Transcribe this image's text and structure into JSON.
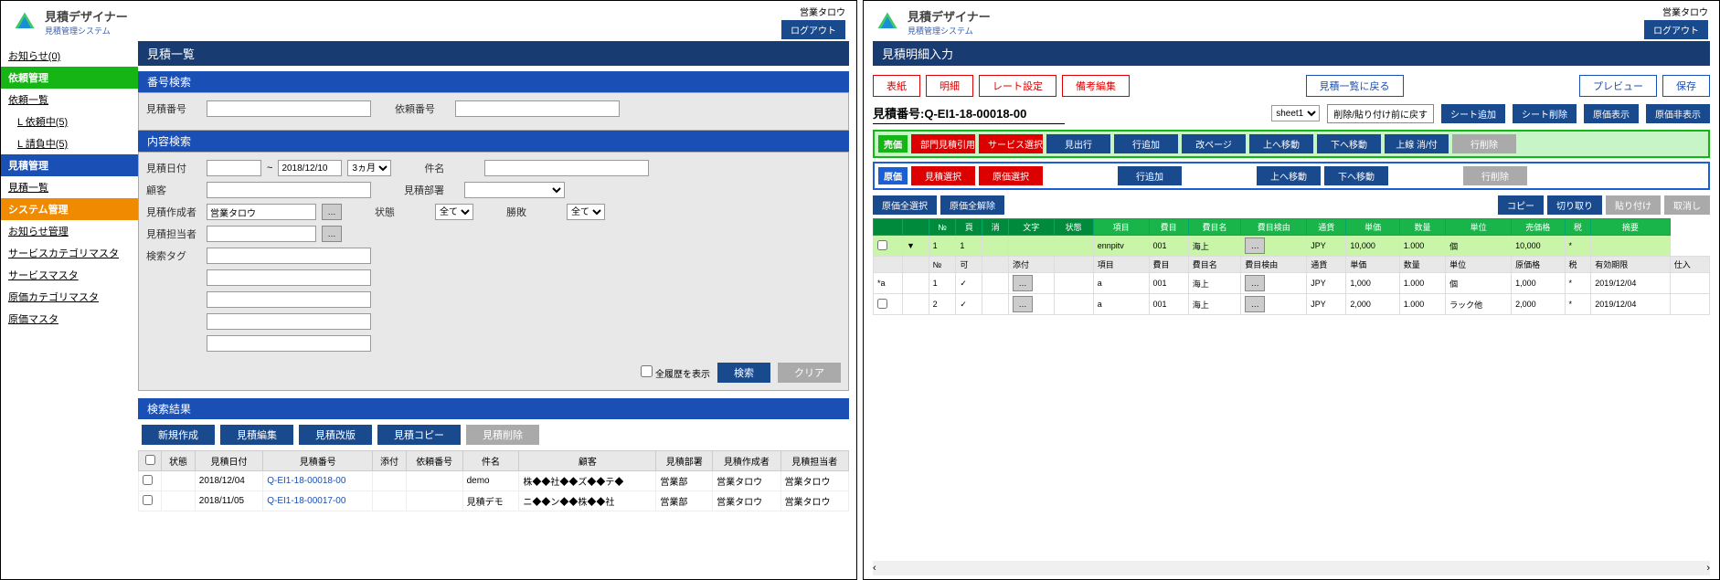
{
  "app": {
    "name": "見積デザイナー",
    "sub": "見積管理システム"
  },
  "user": {
    "name": "営業タロウ",
    "logout": "ログアウト"
  },
  "left": {
    "title": "見積一覧",
    "sidebar": {
      "notice": "お知らせ(0)",
      "s1": "依頼管理",
      "s1a": "依頼一覧",
      "s1b": "L 依頼中(5)",
      "s1c": "L 請負中(5)",
      "s2": "見積管理",
      "s2a": "見積一覧",
      "s3": "システム管理",
      "s3a": "お知らせ管理",
      "s3b": "サービスカテゴリマスタ",
      "s3c": "サービスマスタ",
      "s3d": "原価カテゴリマスタ",
      "s3e": "原価マスタ"
    },
    "sec1": "番号検索",
    "f": {
      "quote_no": "見積番号",
      "req_no": "依頼番号",
      "date": "見積日付",
      "date_to": "2018/12/10",
      "range": "3ヵ月",
      "title": "件名",
      "cust": "顧客",
      "dept": "見積部署",
      "creator": "見積作成者",
      "creator_v": "営業タロウ",
      "status": "状態",
      "status_v": "全て",
      "winrate": "勝敗",
      "winrate_v": "全て",
      "owner": "見積担当者",
      "tag": "検索タグ",
      "showhist": "全履歴を表示",
      "search": "検索",
      "clear": "クリア"
    },
    "sec2": "内容検索",
    "results": "検索結果",
    "actions": {
      "new": "新規作成",
      "edit": "見積編集",
      "rev": "見積改版",
      "copy": "見積コピー",
      "del": "見積削除"
    },
    "cols": {
      "st": "状態",
      "date": "見積日付",
      "qno": "見積番号",
      "att": "添付",
      "rno": "依頼番号",
      "title": "件名",
      "cust": "顧客",
      "dept": "見積部署",
      "creator": "見積作成者",
      "owner": "見積担当者"
    },
    "rows": [
      {
        "date": "2018/12/04",
        "qno": "Q-EI1-18-00018-00",
        "title": "demo",
        "cust": "株◆◆社◆◆ズ◆◆テ◆",
        "dept": "営業部",
        "creator": "営業タロウ",
        "owner": "営業タロウ"
      },
      {
        "date": "2018/11/05",
        "qno": "Q-EI1-18-00017-00",
        "title": "見積デモ",
        "cust": "ニ◆◆ン◆◆株◆◆社",
        "dept": "営業部",
        "creator": "営業タロウ",
        "owner": "営業タロウ"
      }
    ]
  },
  "right": {
    "title": "見積明細入力",
    "top": {
      "cover": "表紙",
      "detail": "明細",
      "rate": "レート設定",
      "note": "備考編集",
      "back": "見積一覧に戻る",
      "preview": "プレビュー",
      "save": "保存"
    },
    "qlabel": "見積番号:Q-EI1-18-00018-00",
    "sheet": "sheet1",
    "undo": "削除/貼り付け前に戻す",
    "sheet_btns": {
      "add": "シート追加",
      "del": "シート削除",
      "show": "原価表示",
      "hide": "原価非表示"
    },
    "ribbon1": {
      "badge": "売価",
      "b1": "部門見積引用",
      "b2": "サービス選択",
      "b3": "見出行",
      "b4": "行追加",
      "b5": "改ページ",
      "b6": "上へ移動",
      "b7": "下へ移動",
      "b8": "上線 消/付",
      "b9": "行削除"
    },
    "ribbon2": {
      "badge": "原価",
      "b1": "見積選択",
      "b2": "原価選択",
      "b3": "行追加",
      "b6": "上へ移動",
      "b7": "下へ移動",
      "b9": "行削除"
    },
    "tools": {
      "selall": "原価全選択",
      "unsel": "原価全解除",
      "copy": "コピー",
      "cut": "切り取り",
      "paste": "貼り付け",
      "undo2": "取消し"
    },
    "grid_h1": [
      "",
      "",
      "№",
      "頁",
      "消",
      "文字",
      "状態",
      "項目",
      "費目",
      "費目名",
      "費目検由",
      "通貨",
      "単価",
      "数量",
      "単位",
      "売価格",
      "税",
      "摘要"
    ],
    "grid_r1": [
      "",
      "▼",
      "1",
      "1",
      "",
      "",
      "",
      "ennpitv",
      "001",
      "海上",
      "―",
      "JPY",
      "10,000",
      "1.000",
      "個",
      "10,000",
      "*",
      ""
    ],
    "grid_h2": [
      "",
      "",
      "№",
      "可",
      "",
      "添付",
      "",
      "項目",
      "費目",
      "費目名",
      "費目検由",
      "通貨",
      "単価",
      "数量",
      "単位",
      "原価格",
      "税",
      "有効期限",
      "仕入"
    ],
    "grid_r2": [
      "*a",
      "",
      "1",
      "✓",
      "",
      "―",
      "",
      "a",
      "001",
      "海上",
      "―",
      "JPY",
      "1,000",
      "1.000",
      "個",
      "1,000",
      "*",
      "2019/12/04",
      ""
    ],
    "grid_r3": [
      "",
      "",
      "2",
      "✓",
      "",
      "―",
      "",
      "a",
      "001",
      "海上",
      "―",
      "JPY",
      "2,000",
      "1.000",
      "ラック他",
      "2,000",
      "*",
      "2019/12/04",
      ""
    ]
  }
}
